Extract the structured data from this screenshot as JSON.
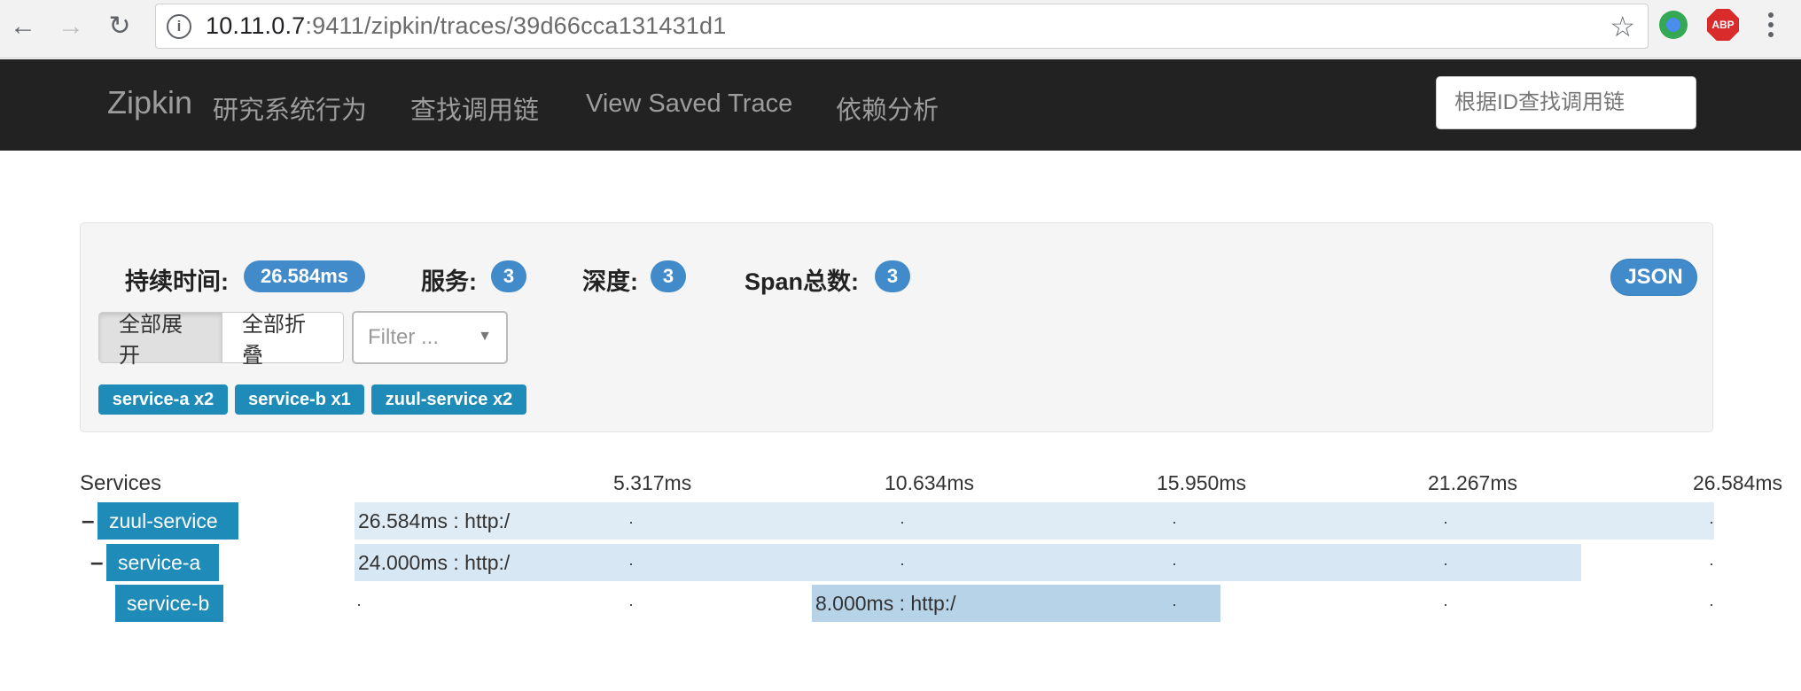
{
  "browser": {
    "url_host": "10.11.0.7",
    "url_rest": ":9411/zipkin/traces/39d66cca131431d1",
    "abp_label": "ABP"
  },
  "navbar": {
    "brand": "Zipkin",
    "links": [
      "研究系统行为",
      "查找调用链",
      "View Saved Trace",
      "依赖分析"
    ],
    "search_placeholder": "根据ID查找调用链"
  },
  "summary": {
    "duration_label": "持续时间:",
    "duration_value": "26.584ms",
    "services_label": "服务:",
    "services_value": "3",
    "depth_label": "深度:",
    "depth_value": "3",
    "span_count_label": "Span总数:",
    "span_count_value": "3",
    "json_label": "JSON",
    "expand_all": "全部展开",
    "collapse_all": "全部折叠",
    "filter_placeholder": "Filter ...",
    "service_tags": [
      "service-a x2",
      "service-b x1",
      "zuul-service x2"
    ]
  },
  "timeline": {
    "services_header": "Services",
    "ticks": [
      "5.317ms",
      "10.634ms",
      "15.950ms",
      "21.267ms",
      "26.584ms"
    ],
    "rows": [
      {
        "expander": "–",
        "service": "zuul-service",
        "span_label": "26.584ms : http:/"
      },
      {
        "expander": "–",
        "service": "service-a",
        "span_label": "24.000ms : http:/"
      },
      {
        "expander": "",
        "service": "service-b",
        "span_label": "8.000ms : http:/"
      }
    ]
  }
}
